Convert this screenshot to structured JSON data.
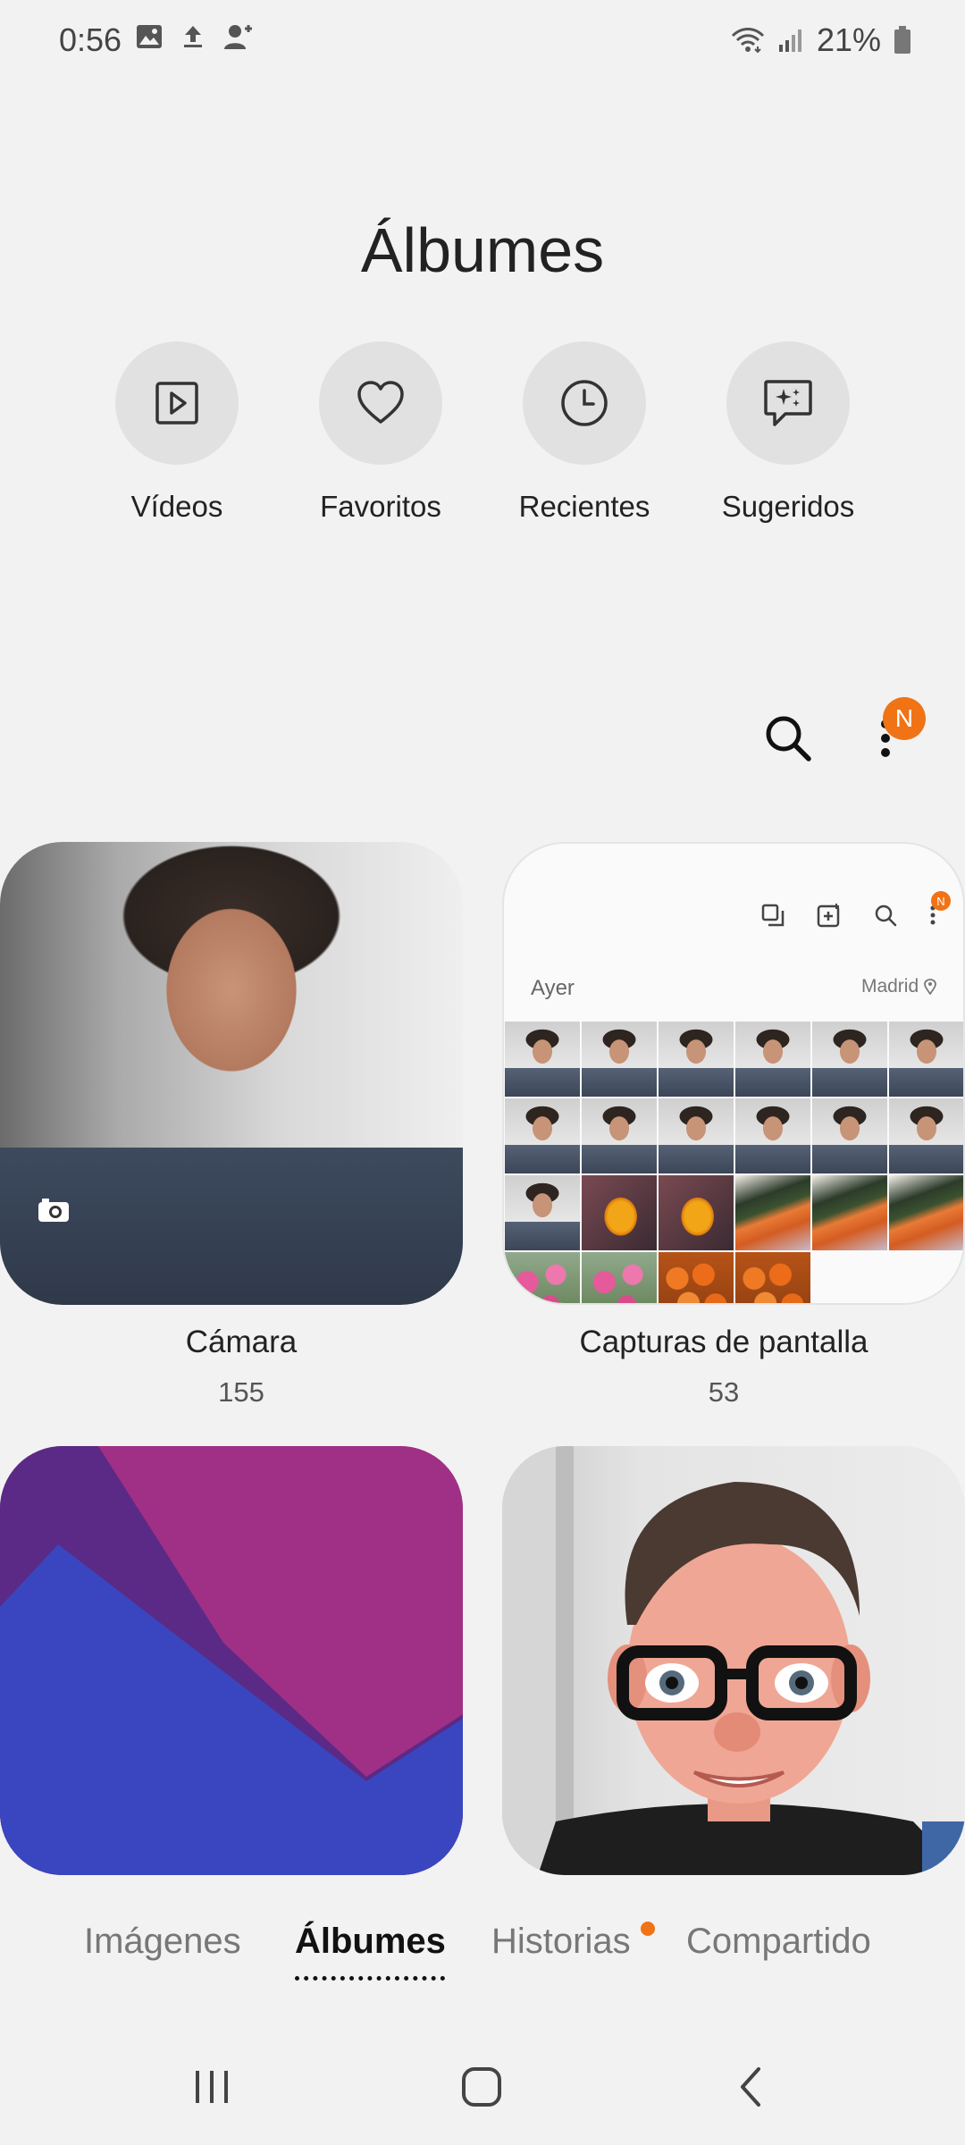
{
  "status_bar": {
    "time": "0:56",
    "battery": "21%",
    "icons": [
      "gallery-icon",
      "upload-icon",
      "add-user-icon",
      "wifi-icon",
      "signal-icon",
      "battery-icon"
    ]
  },
  "header": {
    "title": "Álbumes"
  },
  "quick_albums": [
    {
      "label": "Vídeos",
      "icon": "video-icon"
    },
    {
      "label": "Favoritos",
      "icon": "heart-icon"
    },
    {
      "label": "Recientes",
      "icon": "clock-icon"
    },
    {
      "label": "Sugeridos",
      "icon": "suggested-icon"
    }
  ],
  "toolbar": {
    "notification_badge": "N"
  },
  "albums": [
    {
      "name": "Cámara",
      "count": "155"
    },
    {
      "name": "Capturas de pantalla",
      "count": "53"
    }
  ],
  "screenshot_preview": {
    "date": "Ayer",
    "location": "Madrid",
    "badge": "N"
  },
  "bottom_tabs": [
    {
      "label": "Imágenes",
      "active": false
    },
    {
      "label": "Álbumes",
      "active": true
    },
    {
      "label": "Historias",
      "active": false,
      "has_dot": true
    },
    {
      "label": "Compartido",
      "active": false
    }
  ],
  "colors": {
    "accent": "#f07316",
    "background": "#f2f2f2",
    "quick_circle": "#e1e1e1"
  }
}
